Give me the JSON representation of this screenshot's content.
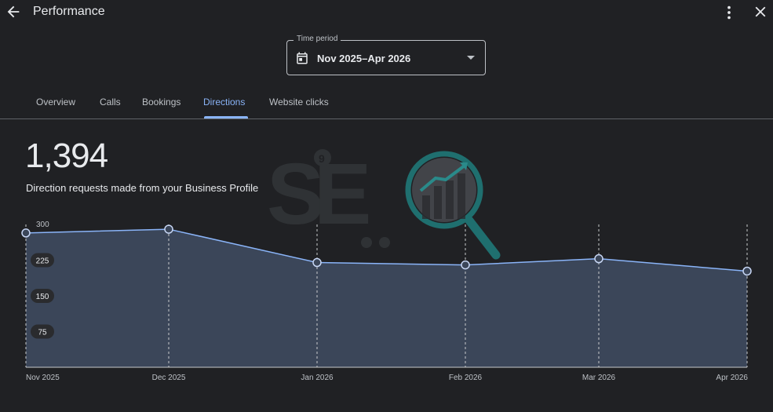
{
  "header": {
    "title": "Performance",
    "icons": [
      "arrow-back-icon",
      "more-vert-icon",
      "close-icon"
    ]
  },
  "time_period": {
    "label": "Time period",
    "value": "Nov 2025–Apr 2026"
  },
  "tabs": [
    {
      "label": "Overview",
      "active": false
    },
    {
      "label": "Calls",
      "active": false
    },
    {
      "label": "Bookings",
      "active": false
    },
    {
      "label": "Directions",
      "active": true
    },
    {
      "label": "Website clicks",
      "active": false
    }
  ],
  "metric": {
    "value": "1,394",
    "description": "Direction requests made from your Business Profile"
  },
  "watermark": {
    "text": "SEO",
    "superscript": "9"
  },
  "colors": {
    "background": "#202124",
    "accent": "#8ab4f8",
    "area_fill": "#3b4659"
  },
  "chart_data": {
    "type": "area",
    "categories": [
      "Nov 2025",
      "Dec 2025",
      "Jan 2026",
      "Feb 2026",
      "Mar 2026",
      "Apr 2026"
    ],
    "values": [
      282,
      290,
      220,
      215,
      228,
      202
    ],
    "yticks": [
      300,
      225,
      150,
      75
    ],
    "ylim": [
      0,
      300
    ],
    "grid": "vertical-dashed"
  }
}
